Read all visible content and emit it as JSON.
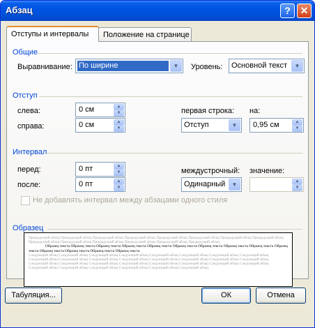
{
  "window": {
    "title": "Абзац",
    "help_label": "?",
    "close_label": "✕"
  },
  "tabs": {
    "indents": "Отступы и интервалы",
    "position": "Положение на странице"
  },
  "general": {
    "title": "Общие",
    "alignment_label": "Выравнивание:",
    "alignment_value": "По ширине",
    "level_label": "Уровень:",
    "level_value": "Основной текст"
  },
  "indent": {
    "title": "Отступ",
    "left_label": "слева:",
    "left_value": "0 см",
    "right_label": "справа:",
    "right_value": "0 см",
    "first_line_label": "первая строка:",
    "first_line_value": "Отступ",
    "on_label": "на:",
    "on_value": "0,95 см"
  },
  "spacing": {
    "title": "Интервал",
    "before_label": "перед:",
    "before_value": "0 пт",
    "after_label": "после:",
    "after_value": "0 пт",
    "line_spacing_label": "междустрочный:",
    "line_spacing_value": "Одинарный",
    "value_label": "значение:",
    "value_value": "",
    "no_space_label": "Не добавлять интервал между абзацами одного стиля"
  },
  "preview": {
    "title": "Образец",
    "prev_text": "Предыдущий абзац Предыдущий абзац Предыдущий абзац Предыдущий абзац Предыдущий абзац Предыдущий абзац Предыдущий абзац Предыдущий абзац Предыдущий абзац Предыдущий абзац Предыдущий абзац Предыдущий абзац Предыдущий абзац Предыдущий абзац",
    "cur_text": "Образец текста Образец текста Образец текста Образец текста Образец текста Образец текста Образец текста Образец текста Образец текста Образец текста Образец текста Образец текста Образец текста Образец текста",
    "next_text": "Следующий абзац Следующий абзац Следующий абзац Следующий абзац Следующий абзац Следующий абзац Следующий абзац Следующий абзац Следующий абзац Следующий абзац Следующий абзац Следующий абзац Следующий абзац Следующий абзац Следующий абзац Следующий абзац Следующий абзац Следующий абзац Следующий абзац Следующий абзац Следующий абзац Следующий абзац Следующий абзац Следующий абзац Следующий абзац Следующий абзац Следующий абзац Следующий абзац Следующий абзац Следующий абзац"
  },
  "buttons": {
    "tabs": "Табуляция...",
    "ok": "ОК",
    "cancel": "Отмена"
  }
}
